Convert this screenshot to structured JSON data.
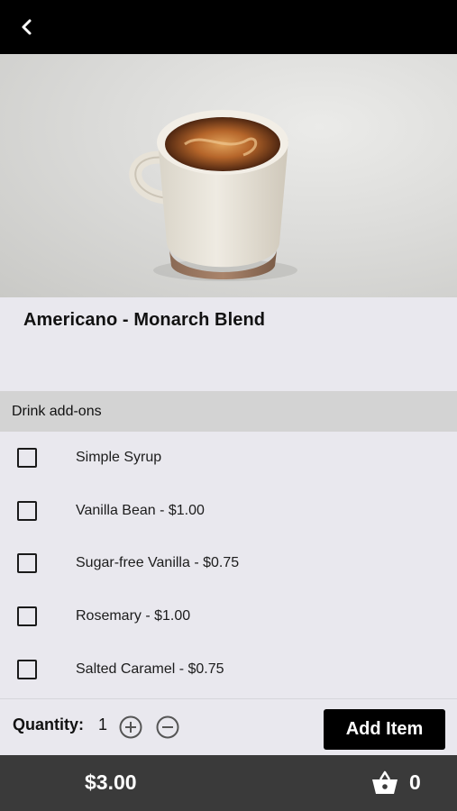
{
  "product": {
    "title": "Americano - Monarch Blend"
  },
  "addons": {
    "header": "Drink add-ons",
    "items": [
      {
        "label": "Simple Syrup",
        "checked": false
      },
      {
        "label": "Vanilla Bean - $1.00",
        "checked": false
      },
      {
        "label": "Sugar-free Vanilla - $0.75",
        "checked": false
      },
      {
        "label": "Rosemary - $1.00",
        "checked": false
      },
      {
        "label": "Salted Caramel - $0.75",
        "checked": false
      }
    ]
  },
  "quantity": {
    "label": "Quantity:",
    "value": "1"
  },
  "actions": {
    "add_item_label": "Add Item"
  },
  "footer": {
    "total": "$3.00",
    "cart_count": "0"
  },
  "icons": {
    "back": "chevron-left-icon",
    "increment": "plus-circle-icon",
    "decrement": "minus-circle-icon",
    "cart": "basket-icon"
  },
  "colors": {
    "topbar": "#000000",
    "background": "#e9e8ee",
    "section_header": "#d3d3d3",
    "footer": "#3a3a3a",
    "button": "#000000"
  }
}
